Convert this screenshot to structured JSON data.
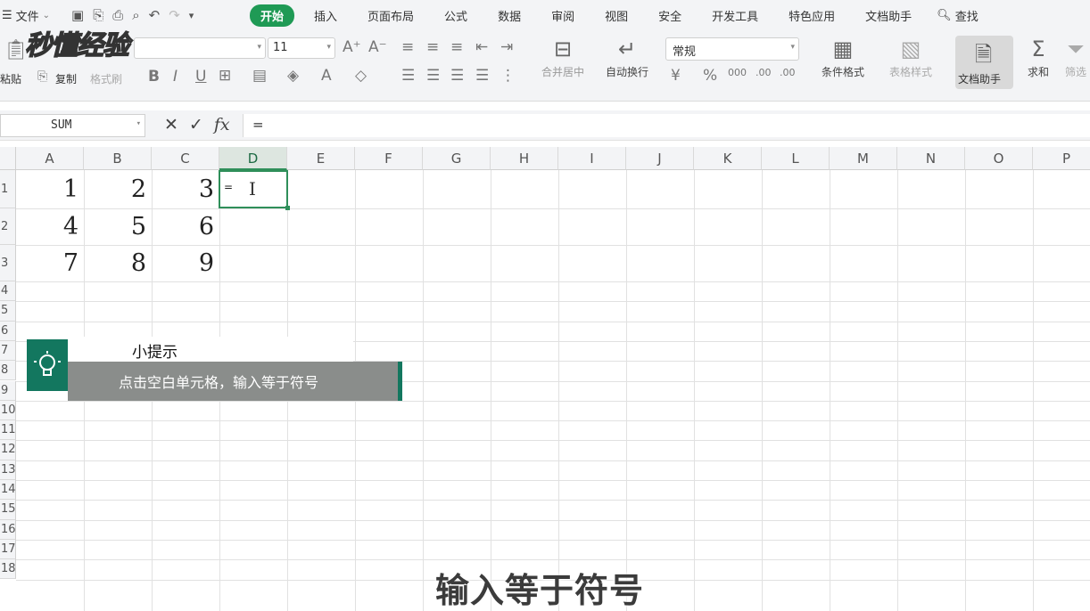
{
  "menubar": {
    "file_label": "文件",
    "tabs": [
      "开始",
      "插入",
      "页面布局",
      "公式",
      "数据",
      "审阅",
      "视图",
      "安全",
      "开发工具",
      "特色应用",
      "文档助手"
    ],
    "active_tab": "开始",
    "search_label": "查找"
  },
  "ribbon": {
    "paste_label": "粘贴",
    "copy_label": "复制",
    "format_painter_label": "格式刷",
    "font_size": "11",
    "number_format": "常规",
    "merge_label": "合并居中",
    "wrap_label": "自动换行",
    "conditional_format_label": "条件格式",
    "table_style_label": "表格样式",
    "doc_helper_label": "文档助手",
    "sum_label": "求和",
    "filter_label": "筛选"
  },
  "formula_bar": {
    "name_box": "SUM",
    "fx_label": "fx",
    "content": "="
  },
  "sheet": {
    "columns": [
      "A",
      "B",
      "C",
      "D",
      "E",
      "F",
      "G",
      "H",
      "I",
      "J",
      "K",
      "L",
      "M",
      "N",
      "O",
      "P"
    ],
    "selected_column": "D",
    "rows": [
      "1",
      "2",
      "3",
      "4",
      "5",
      "6",
      "7",
      "8",
      "9",
      "10",
      "11",
      "12",
      "13",
      "14",
      "15",
      "16",
      "17",
      "18"
    ],
    "values": [
      [
        "1",
        "2",
        "3"
      ],
      [
        "4",
        "5",
        "6"
      ],
      [
        "7",
        "8",
        "9"
      ]
    ],
    "active_cell_text": "="
  },
  "tip": {
    "title": "小提示",
    "body": "点击空白单元格，输入等于符号"
  },
  "subtitle": "输入等于符号",
  "watermark": "秒懂经验",
  "colors": {
    "accent_green": "#1f9a55",
    "tip_green": "#13775f"
  }
}
